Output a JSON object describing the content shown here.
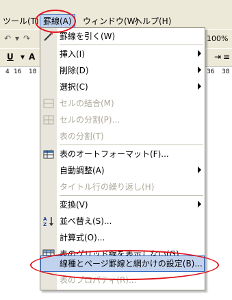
{
  "menubar": {
    "tools": "ツール(T)",
    "table": "罫線(A)",
    "window": "ウィンドウ(W)",
    "help": "ヘルプ(H)"
  },
  "toolbar": {
    "zoom": "100%"
  },
  "ruler": {
    "ticks": [
      "4",
      "16",
      "18",
      "36",
      "38"
    ]
  },
  "dropdown": {
    "items": [
      {
        "label": "罫線を引く(W)",
        "enabled": true,
        "icon": "pencil-icon"
      },
      {
        "label": "挿入(I)",
        "enabled": true,
        "submenu": true
      },
      {
        "label": "削除(D)",
        "enabled": true,
        "submenu": true
      },
      {
        "label": "選択(C)",
        "enabled": true,
        "submenu": true
      },
      {
        "label": "セルの結合(M)",
        "enabled": false,
        "icon": "merge-cells-icon"
      },
      {
        "label": "セルの分割(P)...",
        "enabled": false,
        "icon": "split-cells-icon"
      },
      {
        "label": "表の分割(T)",
        "enabled": false
      },
      {
        "label": "表のオートフォーマット(F)...",
        "enabled": true,
        "icon": "table-autoformat-icon"
      },
      {
        "label": "自動調整(A)",
        "enabled": true,
        "submenu": true
      },
      {
        "label": "タイトル行の繰り返し(H)",
        "enabled": false
      },
      {
        "label": "変換(V)",
        "enabled": true,
        "submenu": true
      },
      {
        "label": "並べ替え(S)...",
        "enabled": true,
        "icon": "sort-az-icon"
      },
      {
        "label": "計算式(O)...",
        "enabled": true
      },
      {
        "label": "表のグリッド線を表示しない(G)",
        "enabled": true,
        "icon": "grid-icon"
      },
      {
        "label": "線種とページ罫線と網かけの設定(B)...",
        "enabled": true,
        "highlighted": true
      },
      {
        "label": "表のプロパティ(R)...",
        "enabled": false
      }
    ]
  },
  "colors": {
    "menu_bg": "#ece9d8",
    "highlight": "#c1d2ee",
    "highlight_border": "#316ac5",
    "disabled_text": "#aca899",
    "annotation": "#e0141c"
  }
}
